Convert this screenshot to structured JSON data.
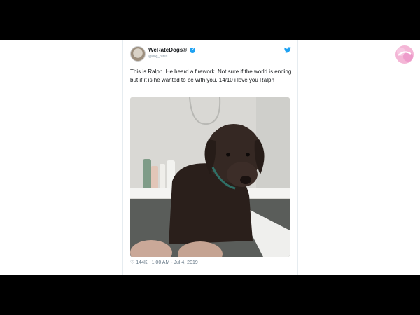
{
  "tweet": {
    "display_name": "WeRateDogs®",
    "handle": "@dog_rates",
    "text": "This is Ralph. He heard a firework. Not sure if the world is ending but if it is he wanted to be with you. 14/10 i love you Ralph",
    "likes": "144K",
    "timestamp": "1:00 AM - Jul 4, 2019"
  },
  "icons": {
    "verified": "verified-badge-icon",
    "platform": "twitter-bird-icon",
    "like": "heart-icon"
  },
  "colors": {
    "accent": "#1da1f2",
    "text": "#14171a",
    "muted": "#657786",
    "letterbox": "#000000"
  }
}
